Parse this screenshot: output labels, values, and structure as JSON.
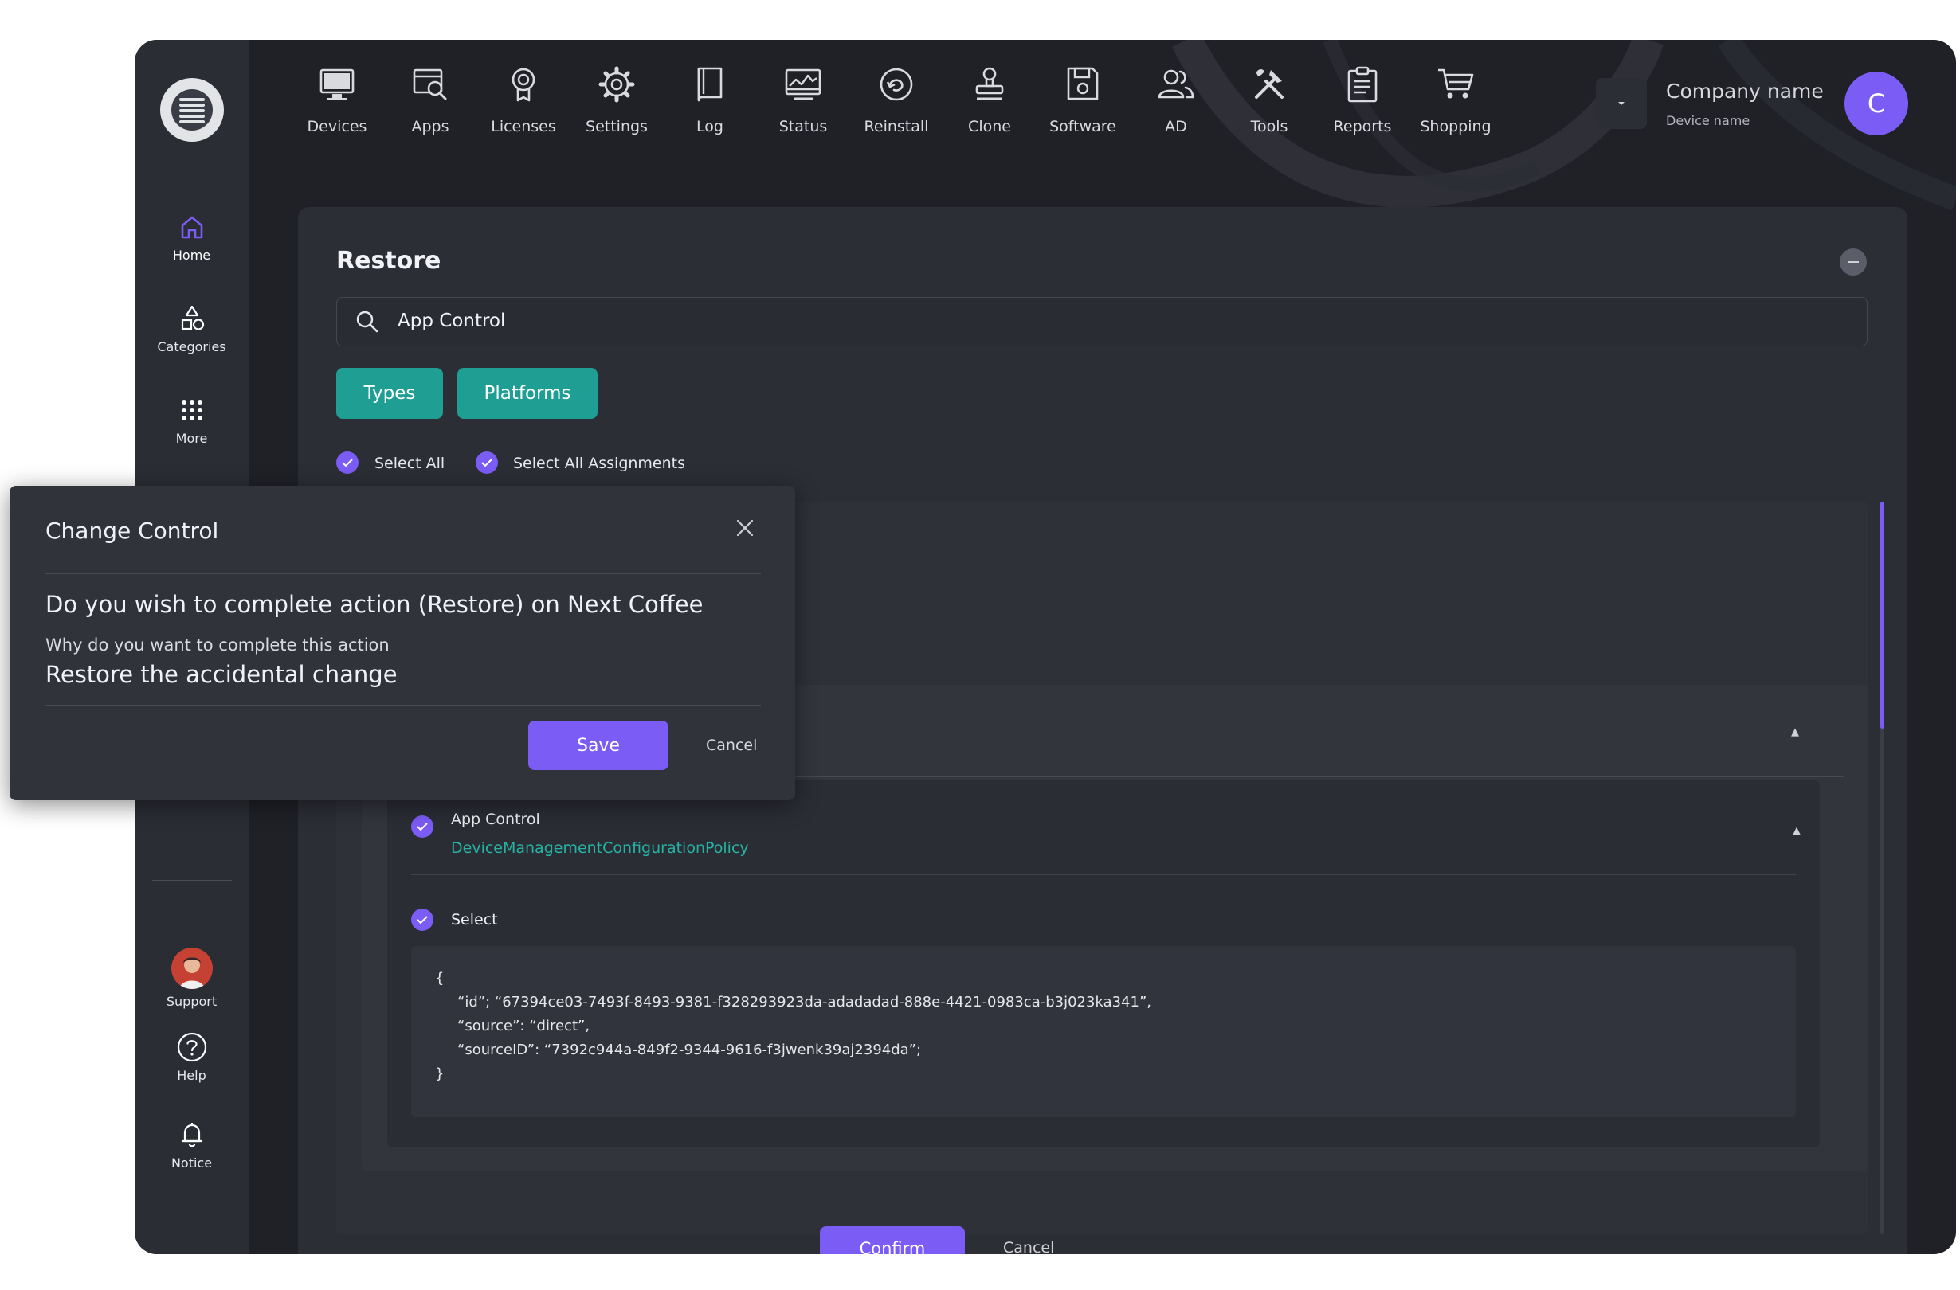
{
  "sidebar": {
    "items": [
      {
        "label": "Home",
        "icon": "home-icon"
      },
      {
        "label": "Categories",
        "icon": "categories-icon"
      },
      {
        "label": "More",
        "icon": "more-icon"
      }
    ],
    "bottom": [
      {
        "label": "Support",
        "icon": "support-avatar"
      },
      {
        "label": "Help",
        "icon": "help-icon"
      },
      {
        "label": "Notice",
        "icon": "bell-icon"
      }
    ]
  },
  "topnav": {
    "items": [
      {
        "label": "Devices",
        "icon": "monitor-icon"
      },
      {
        "label": "Apps",
        "icon": "apps-icon"
      },
      {
        "label": "Licenses",
        "icon": "license-icon"
      },
      {
        "label": "Settings",
        "icon": "gear-icon"
      },
      {
        "label": "Log",
        "icon": "book-icon"
      },
      {
        "label": "Status",
        "icon": "status-icon"
      },
      {
        "label": "Reinstall",
        "icon": "reinstall-icon"
      },
      {
        "label": "Clone",
        "icon": "stamp-icon"
      },
      {
        "label": "Software",
        "icon": "save-icon"
      },
      {
        "label": "AD",
        "icon": "users-icon"
      },
      {
        "label": "Tools",
        "icon": "tools-icon"
      },
      {
        "label": "Reports",
        "icon": "clipboard-icon"
      },
      {
        "label": "Shopping",
        "icon": "cart-icon"
      }
    ]
  },
  "account": {
    "company_name": "Company name",
    "device_name": "Device name",
    "avatar_initial": "C"
  },
  "restore": {
    "title": "Restore",
    "search_value": "App Control",
    "filters": {
      "types": "Types",
      "platforms": "Platforms"
    },
    "select_all": "Select All",
    "select_all_assignments": "Select All Assignments",
    "item": {
      "title": "App Control",
      "subtitle": "DeviceManagementConfigurationPolicy",
      "select_label": "Select"
    },
    "code": {
      "open": "{",
      "line_id": "“id”; “67394ce03-7493f-8493-9381-f328293923da-adadadad-888e-4421-0983ca-b3j023ka341”,",
      "line_source": "“source”: “direct”,",
      "line_source_id": "“sourceID”: “7392c944a-849f2-9344-9616-f3jwenk39aj2394da”;",
      "close": "}"
    },
    "confirm_label": "Confirm",
    "cancel_label": "Cancel"
  },
  "modal": {
    "title": "Change Control",
    "question": "Do you wish to complete action (Restore) on Next Coffee",
    "why_label": "Why do you want to complete this action",
    "reason": "Restore the accidental change",
    "save_label": "Save",
    "cancel_label": "Cancel"
  },
  "colors": {
    "accent": "#7b5cf5",
    "teal": "#1f9e93",
    "link": "#26b3a5",
    "background": "#1f2127",
    "panel": "#2c2e36"
  }
}
